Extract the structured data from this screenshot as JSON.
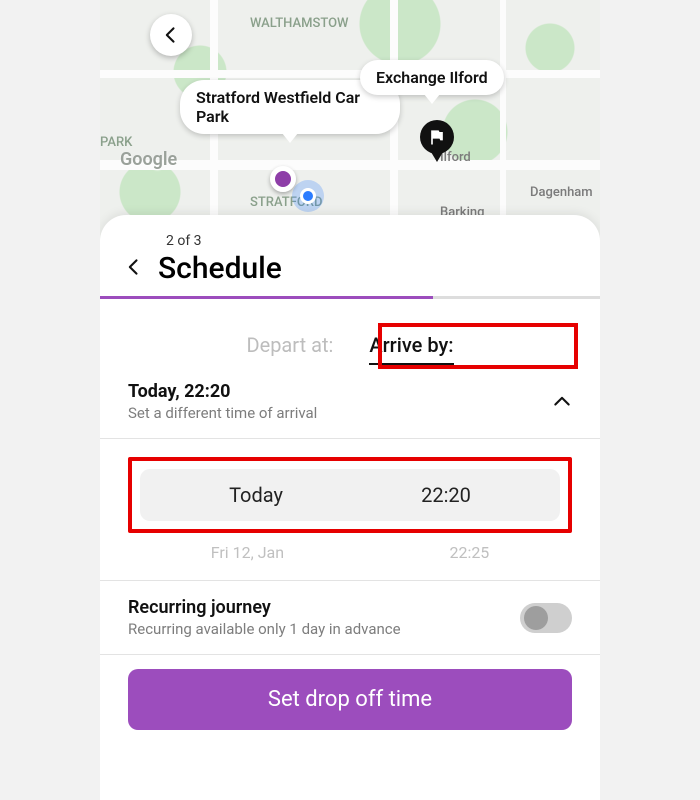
{
  "map": {
    "origin_label": "Stratford Westfield Car Park",
    "dest_label": "Exchange Ilford",
    "place_labels": {
      "walthamstow": "WALTHAMSTOW",
      "stratford": "STRATFORD",
      "ilford": "Ilford",
      "barking": "Barking",
      "dagenham": "Dagenham",
      "park": "PARK"
    },
    "attribution": "Google"
  },
  "sheet": {
    "step_label": "2 of 3",
    "title": "Schedule",
    "tabs": {
      "depart": "Depart at:",
      "arrive": "Arrive by:"
    },
    "timesection": {
      "heading": "Today, 22:20",
      "subtext": "Set a different time of arrival"
    },
    "picker": {
      "selected_day": "Today",
      "selected_time": "22:20",
      "next_day": "Fri 12, Jan",
      "next_time": "22:25"
    },
    "recurring": {
      "title": "Recurring journey",
      "subtext": "Recurring available only 1 day in advance"
    },
    "cta": "Set drop off time"
  }
}
